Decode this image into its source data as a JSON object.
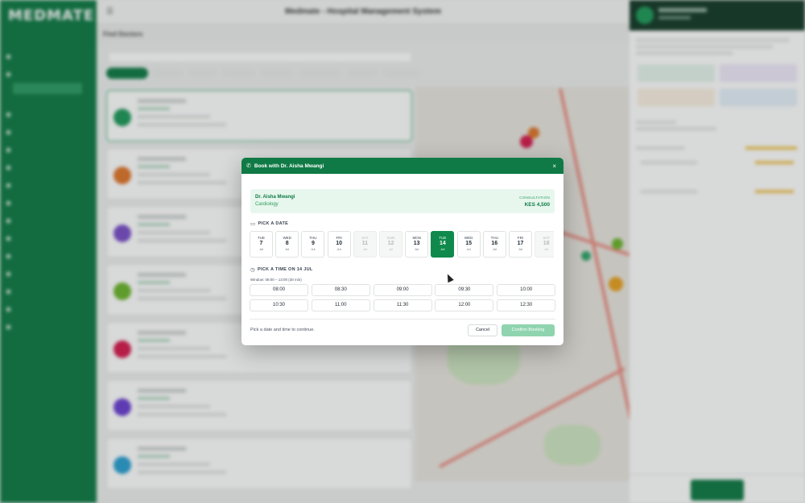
{
  "app": {
    "logo": "MEDMATE",
    "title": "Medmate - Hospital Management System",
    "menu_icon": "hamburger-icon",
    "section": "Find Doctors"
  },
  "modal": {
    "title": "Book with Dr. Aisha Mwangi",
    "header_icon": "phone-icon",
    "close_icon": "close-icon",
    "close_glyph": "×",
    "doctor": {
      "name": "Dr. Aisha Mwangi",
      "specialty": "Cardiology",
      "fee_label": "CONSULTATION",
      "fee": "KES 4,500"
    },
    "date_section_label": "PICK A DATE",
    "date_section_icon": "calendar-icon",
    "dates": [
      {
        "dow": "TUE",
        "day": "7",
        "month": "Jul",
        "state": "available"
      },
      {
        "dow": "WED",
        "day": "8",
        "month": "Jul",
        "state": "available"
      },
      {
        "dow": "THU",
        "day": "9",
        "month": "Jul",
        "state": "available"
      },
      {
        "dow": "FRI",
        "day": "10",
        "month": "Jul",
        "state": "available"
      },
      {
        "dow": "SAT",
        "day": "11",
        "month": "Jul",
        "state": "disabled"
      },
      {
        "dow": "SUN",
        "day": "12",
        "month": "Jul",
        "state": "disabled"
      },
      {
        "dow": "MON",
        "day": "13",
        "month": "Jul",
        "state": "available"
      },
      {
        "dow": "TUE",
        "day": "14",
        "month": "Jul",
        "state": "selected"
      },
      {
        "dow": "WED",
        "day": "15",
        "month": "Jul",
        "state": "available"
      },
      {
        "dow": "THU",
        "day": "16",
        "month": "Jul",
        "state": "available"
      },
      {
        "dow": "FRI",
        "day": "17",
        "month": "Jul",
        "state": "available"
      },
      {
        "dow": "SAT",
        "day": "18",
        "month": "Jul",
        "state": "disabled"
      }
    ],
    "time_section_label": "PICK A TIME ON 14 JUL",
    "time_section_icon": "clock-icon",
    "window_text": "Window: 08:00 – 13:00 (30 min)",
    "slots": [
      "08:00",
      "08:30",
      "09:00",
      "09:30",
      "10:00",
      "10:30",
      "11:00",
      "11:30",
      "12:00",
      "12:30"
    ],
    "hint": "Pick a date and time to continue.",
    "cancel_label": "Cancel",
    "confirm_label": "Confirm Booking"
  },
  "colors": {
    "brand": "#0f7a45",
    "selected": "#0f8a4c",
    "confirm_disabled": "#8fd4ae",
    "summary_bg": "#e8f7ee"
  }
}
